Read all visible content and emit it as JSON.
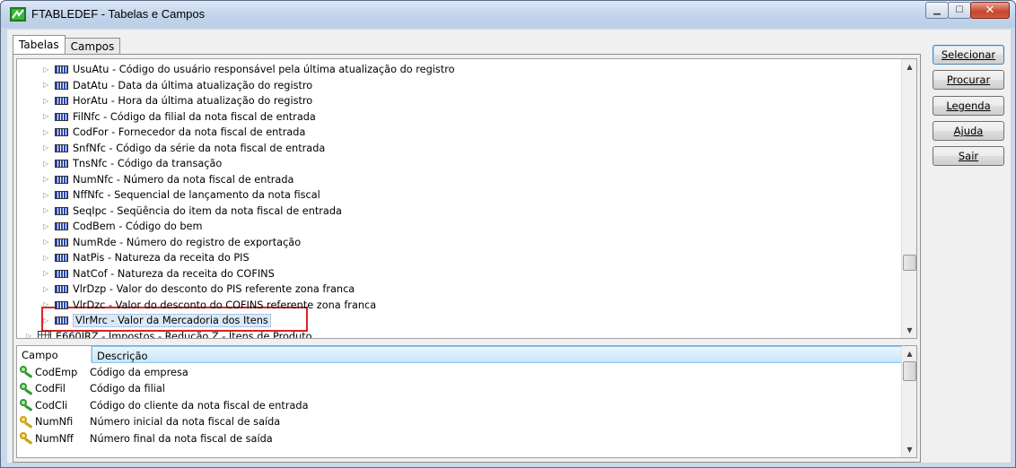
{
  "window": {
    "title": "FTABLEDEF - Tabelas e Campos",
    "controls": {
      "minimize": "▁",
      "maximize": "☐",
      "close": "✕"
    }
  },
  "tabs": [
    {
      "label": "Tabelas",
      "active": true
    },
    {
      "label": "Campos",
      "active": false
    }
  ],
  "tree": {
    "rows": [
      {
        "label": "UsuAtu - Código do usuário responsável pela última atualização do registro",
        "icon": "field-icon"
      },
      {
        "label": "DatAtu - Data da última atualização do registro",
        "icon": "field-icon"
      },
      {
        "label": "HorAtu - Hora da última atualização do registro",
        "icon": "field-icon"
      },
      {
        "label": "FilNfc - Código da filial da nota fiscal de entrada",
        "icon": "field-icon"
      },
      {
        "label": "CodFor - Fornecedor da nota fiscal de entrada",
        "icon": "field-icon"
      },
      {
        "label": "SnfNfc - Código da série da nota fiscal de entrada",
        "icon": "field-icon"
      },
      {
        "label": "TnsNfc - Código da transação",
        "icon": "field-icon"
      },
      {
        "label": "NumNfc - Número da nota fiscal de entrada",
        "icon": "field-icon"
      },
      {
        "label": "NffNfc - Sequencial de lançamento da nota fiscal",
        "icon": "field-icon"
      },
      {
        "label": "SeqIpc - Seqüência do item da nota fiscal de entrada",
        "icon": "field-icon"
      },
      {
        "label": "CodBem - Código do bem",
        "icon": "field-icon"
      },
      {
        "label": "NumRde - Número do registro de exportação",
        "icon": "field-icon"
      },
      {
        "label": "NatPis - Natureza da receita do PIS",
        "icon": "field-icon"
      },
      {
        "label": "NatCof - Natureza da receita do COFINS",
        "icon": "field-icon"
      },
      {
        "label": "VlrDzp - Valor do desconto do PIS referente zona franca",
        "icon": "field-icon"
      },
      {
        "label": "VlrDzc - Valor do desconto do COFINS referente zona franca",
        "icon": "field-icon"
      },
      {
        "label": "VlrMrc - Valor da Mercadoria dos Itens",
        "icon": "field-icon",
        "selected": true
      },
      {
        "label": "E660IRZ - Impostos - Redução Z - Itens de Produto",
        "icon": "table-icon"
      }
    ]
  },
  "grid": {
    "headers": {
      "campo": "Campo",
      "descricao": "Descrição"
    },
    "rows": [
      {
        "campo": "CodEmp",
        "descricao": "Código da empresa",
        "key": "green"
      },
      {
        "campo": "CodFil",
        "descricao": "Código da filial",
        "key": "green"
      },
      {
        "campo": "CodCli",
        "descricao": "Código do cliente da nota fiscal de entrada",
        "key": "green"
      },
      {
        "campo": "NumNfi",
        "descricao": "Número inicial da nota fiscal de saída",
        "key": "yellow"
      },
      {
        "campo": "NumNff",
        "descricao": "Número final da nota fiscal de saída",
        "key": "yellow"
      }
    ]
  },
  "buttons": {
    "selecionar": "Selecionar",
    "procurar": "Procurar",
    "legenda": "Legenda",
    "ajuda": "Ajuda",
    "sair": "Sair"
  }
}
